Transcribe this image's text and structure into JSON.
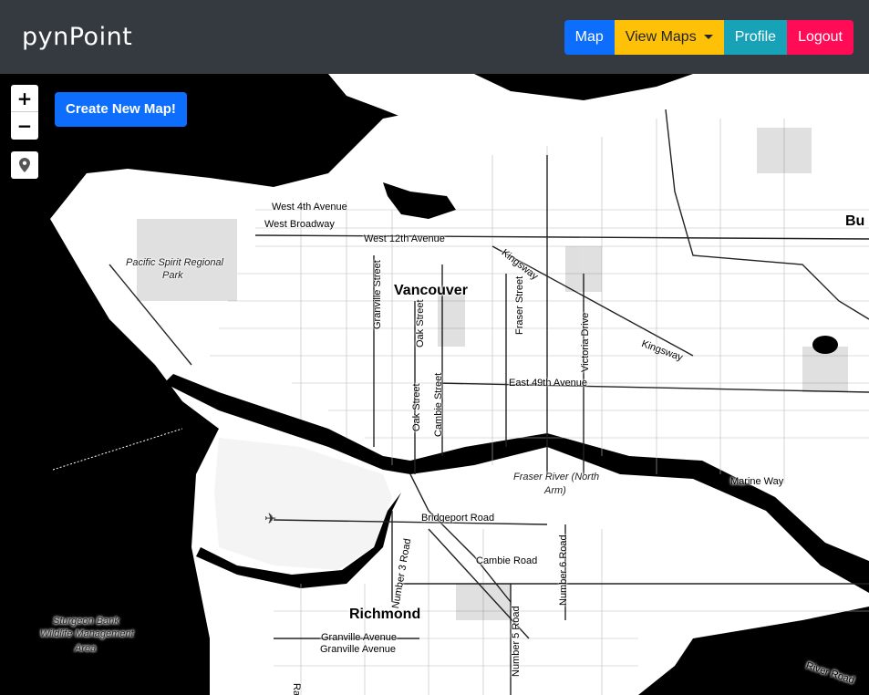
{
  "brand": "pynPoint",
  "nav": {
    "map_label": "Map",
    "view_maps_label": "View Maps",
    "profile_label": "Profile",
    "logout_label": "Logout"
  },
  "map_controls": {
    "zoom_in": "+",
    "zoom_out": "−",
    "create_label": "Create New Map!"
  },
  "map_labels": {
    "west_4th": "West 4th Avenue",
    "west_broadway": "West Broadway",
    "west_12th": "West 12th Avenue",
    "pacific_spirit_1": "Pacific Spirit Regional",
    "pacific_spirit_2": "Park",
    "vancouver": "Vancouver",
    "granville_st": "Granville Street",
    "oak_st_1": "Oak Street",
    "oak_st_2": "Oak Street",
    "cambie_st": "Cambie Street",
    "fraser_st": "Fraser Street",
    "victoria_dr": "Victoria Drive",
    "kingsway_1": "Kingsway",
    "kingsway_2": "Kingsway",
    "east_49th": "East 49th Avenue",
    "fraser_river_1": "Fraser River (North",
    "fraser_river_2": "Arm)",
    "marine_way": "Marine Way",
    "bridgeport": "Bridgeport Road",
    "no3_road": "Number 3 Road",
    "cambie_rd": "Cambie Road",
    "no6_road": "Number 6 Road",
    "richmond": "Richmond",
    "granville_ave_1": "Granville Avenue",
    "granville_ave_2": "Granville Avenue",
    "no5_road": "Number 5 Road",
    "sturgeon_1": "Sturgeon Bank",
    "sturgeon_2": "Wildlife Management",
    "sturgeon_3": "Area",
    "river_road": "River Road",
    "bu": "Bu",
    "ra": "Ra"
  },
  "colors": {
    "navbar_bg": "#343a40",
    "primary": "#0d6efd",
    "warning": "#ffc107",
    "info": "#17a2b8",
    "danger": "#ff0b56"
  }
}
